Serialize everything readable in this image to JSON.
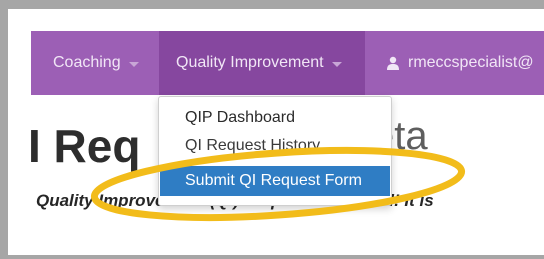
{
  "navbar": {
    "coaching_label": "Coaching",
    "qi_label": "Quality Improvement",
    "user_label": "rmeccspecialist@"
  },
  "page": {
    "heading_left": "I Req",
    "heading_right": "eta",
    "intro_text": "Quality Improvement (QI) Request Form tool! It is"
  },
  "dropdown": {
    "items": [
      {
        "label": "QIP Dashboard"
      },
      {
        "label": "QI Request History"
      },
      {
        "label": "Submit QI Request Form"
      }
    ],
    "selected_index": 2
  },
  "colors": {
    "navbar": "#9c5fb5",
    "navbar_active": "#86479f",
    "selected_item": "#2f7dc4",
    "highlight_ring": "#f2bc1a"
  }
}
